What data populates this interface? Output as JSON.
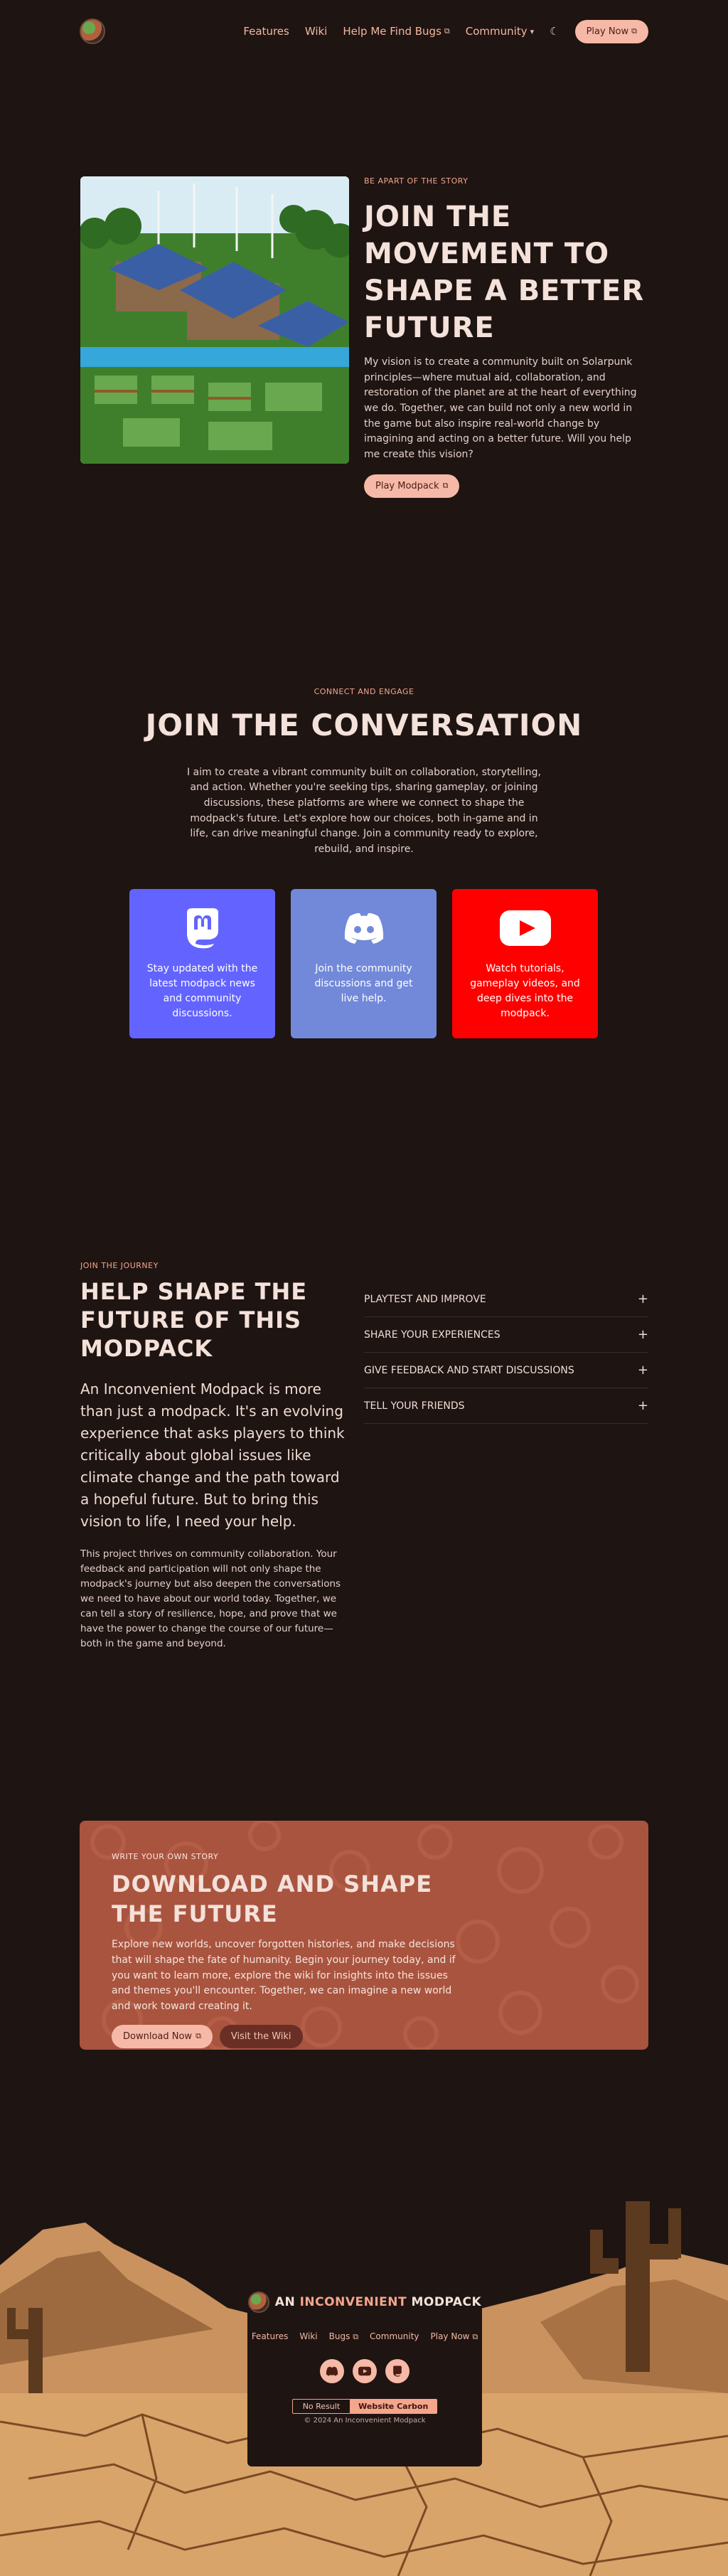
{
  "nav": {
    "links": [
      "Features",
      "Wiki",
      "Help Me Find Bugs",
      "Community"
    ],
    "cta": "Play Now"
  },
  "hero": {
    "eyebrow": "BE APART OF THE STORY",
    "title": "JOIN THE MOVEMENT TO SHAPE A BETTER FUTURE",
    "body": "My vision is to create a community built on Solarpunk principles—where mutual aid, collaboration, and restoration of the planet are at the heart of everything we do. Together, we can build not only a new world in the game but also inspire real-world change by imagining and acting on a better future. Will you help me create this vision?",
    "button": "Play Modpack"
  },
  "conversation": {
    "eyebrow": "CONNECT AND ENGAGE",
    "title": "JOIN THE CONVERSATION",
    "body": "I aim to create a vibrant community built on collaboration, storytelling, and action. Whether you're seeking tips, sharing gameplay, or joining discussions, these platforms are where we connect to shape the modpack's future. Let's explore how our choices, both in-game and in life, can drive meaningful change. Join a community ready to explore, rebuild, and inspire.",
    "cards": [
      {
        "text": "Stay updated with the latest modpack news and community discussions.",
        "color": "#6364ff",
        "icon": "mastodon-icon"
      },
      {
        "text": "Join the community discussions and get live help.",
        "color": "#7289da",
        "icon": "discord-icon"
      },
      {
        "text": "Watch tutorials, gameplay videos, and deep dives into the modpack.",
        "color": "#ff0000",
        "icon": "youtube-icon"
      }
    ]
  },
  "journey": {
    "eyebrow": "JOIN THE JOURNEY",
    "title": "HELP SHAPE THE FUTURE OF THIS MODPACK",
    "lead": "An Inconvenient Modpack is more than just a modpack. It's an evolving experience that asks players to think critically about global issues like climate change and the path toward a hopeful future. But to bring this vision to life, I need your help.",
    "body": "This project thrives on community collaboration. Your feedback and participation will not only shape the modpack's journey but also deepen the conversations we need to have about our world today. Together, we can tell a story of resilience, hope, and prove that we have the power to change the course of our future—both in the game and beyond.",
    "accordion": [
      "PLAYTEST AND IMPROVE",
      "SHARE YOUR EXPERIENCES",
      "GIVE FEEDBACK AND START DISCUSSIONS",
      "TELL YOUR FRIENDS"
    ]
  },
  "download": {
    "eyebrow": "WRITE YOUR OWN STORY",
    "title": "DOWNLOAD AND SHAPE THE FUTURE",
    "body": "Explore new worlds, uncover forgotten histories, and make decisions that will shape the fate of humanity. Begin your journey today, and if you want to learn more, explore the wiki for insights into the issues and themes you'll encounter. Together, we can imagine a new world and work toward creating it.",
    "primary": "Download Now",
    "secondary": "Visit the Wiki"
  },
  "footer": {
    "brand_prefix": "AN ",
    "brand_accent": "INCONVENIENT",
    "brand_suffix": " MODPACK",
    "links": [
      "Features",
      "Wiki",
      "Bugs",
      "Community",
      "Play Now"
    ],
    "carbon_result": "No Result",
    "carbon_label": "Website Carbon",
    "copyright": "© 2024 An Inconvenient Modpack"
  },
  "colors": {
    "accent": "#f4a58b",
    "background": "#1e1412",
    "banner": "#a9543f"
  }
}
